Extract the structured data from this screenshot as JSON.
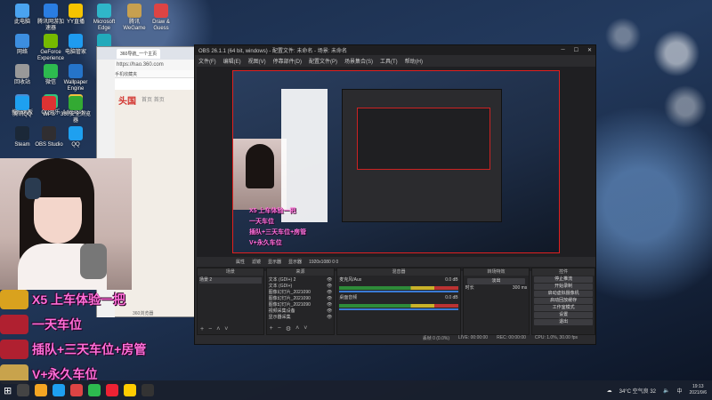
{
  "desktop_icons": [
    {
      "label": "此电脑",
      "color": "#4aa3f0"
    },
    {
      "label": "腾讯网游加速器",
      "color": "#2a7de1"
    },
    {
      "label": "YY直播",
      "color": "#f5c400"
    },
    {
      "label": "Microsoft Edge",
      "color": "#2fb6c9"
    },
    {
      "label": "腾讯WeGame",
      "color": "#c7a050"
    },
    {
      "label": "Draw & Guess",
      "color": "#d44"
    },
    {
      "label": "网络",
      "color": "#3c8ee0"
    },
    {
      "label": "GeForce Experience",
      "color": "#76b900"
    },
    {
      "label": "电脑管家",
      "color": "#1e9bf0"
    },
    {
      "label": "Surf",
      "color": "#2ab"
    },
    {
      "label": "回收站",
      "color": "#999"
    },
    {
      "label": "微信",
      "color": "#2dbb4f"
    },
    {
      "label": "Wallpaper Engine",
      "color": "#2574c9"
    },
    {
      "label": "WeGa",
      "color": "#333"
    },
    {
      "label": "控制面板",
      "color": "#4a8cd4"
    },
    {
      "label": "QQ音乐",
      "color": "#31c27c"
    },
    {
      "label": "Administr...",
      "color": "#f0c040"
    },
    {
      "label": "腾讯QQ",
      "color": "#1ea0f0"
    },
    {
      "label": "WPS",
      "color": "#d33"
    },
    {
      "label": "360安全浏览器",
      "color": "#3a3"
    },
    {
      "label": "Steam",
      "color": "#1b2838"
    },
    {
      "label": "OBS Studio",
      "color": "#302e31"
    },
    {
      "label": "QQ",
      "color": "#1ea0f0"
    }
  ],
  "browser": {
    "tab_title": "360导航_一个主页",
    "address": "https://hao.360.com",
    "bookmarks": "收藏 | 手机收藏夹",
    "brand": "头国",
    "nav": [
      "首页",
      "首页"
    ],
    "bottom_text": "360浏览器"
  },
  "overlays": [
    {
      "text": "X5 上车体验一把",
      "badge_color": "#d9a21e"
    },
    {
      "text": "一天车位",
      "badge_color": "#b02030"
    },
    {
      "text": "插队+三天车位+房管",
      "badge_color": "#b02030"
    },
    {
      "text": "V+永久车位",
      "badge_color": "#c8a34c"
    }
  ],
  "obs": {
    "title": "OBS 26.1.1 (64 bit, windows) - 配置文件: 未命名 - 场景: 未命名",
    "menu": [
      "文件(F)",
      "编辑(E)",
      "视图(V)",
      "停靠部件(D)",
      "配置文件(P)",
      "场景集合(S)",
      "工具(T)",
      "帮助(H)"
    ],
    "canvas_texts": [
      "X5 上车体验一把",
      "一天车位",
      "插队+三天车位+房管",
      "V+永久车位"
    ],
    "scene_bar": [
      "属性",
      "滤镜",
      "显示器",
      "显示器",
      "1920x1080 0 0"
    ],
    "docks": {
      "scenes": {
        "title": "场景",
        "items": [
          "场景 2"
        ]
      },
      "sources": {
        "title": "来源",
        "items": [
          "文本 (GDI+) 2",
          "文本 (GDI+)",
          "图像幻灯片_2021090",
          "图像幻灯片_2021090",
          "图像幻灯片_2021090",
          "视频采集设备",
          "显示器采集"
        ]
      },
      "mixer": {
        "title": "混音器",
        "channels": [
          {
            "name": "麦克风/Aux",
            "level": "0.0 dB"
          },
          {
            "name": "桌面音频",
            "level": "0.0 dB"
          }
        ]
      },
      "transitions": {
        "title": "转场特效",
        "type": "淡出",
        "duration_label": "时长",
        "duration": "300 ms"
      },
      "controls": {
        "title": "控件",
        "buttons": [
          "停止推流",
          "开始录制",
          "启动虚拟摄像机",
          "启动回放缓存",
          "工作室模式",
          "设置",
          "退出"
        ]
      }
    },
    "status": {
      "dropped": "丢帧 0 (0.0%)",
      "live": "LIVE: 00:00:00",
      "rec": "REC: 00:00:00",
      "cpu": "CPU: 1.0%, 30.00 fps"
    }
  },
  "taskbar": {
    "apps": [
      "#444",
      "#f5a623",
      "#1ea0f0",
      "#d44",
      "#2dbb4f",
      "#e23",
      "#fc0",
      "#333"
    ],
    "weather": "34°C 空气良 32",
    "ime": "中",
    "time": "19:13",
    "date": "2021/9/6"
  }
}
